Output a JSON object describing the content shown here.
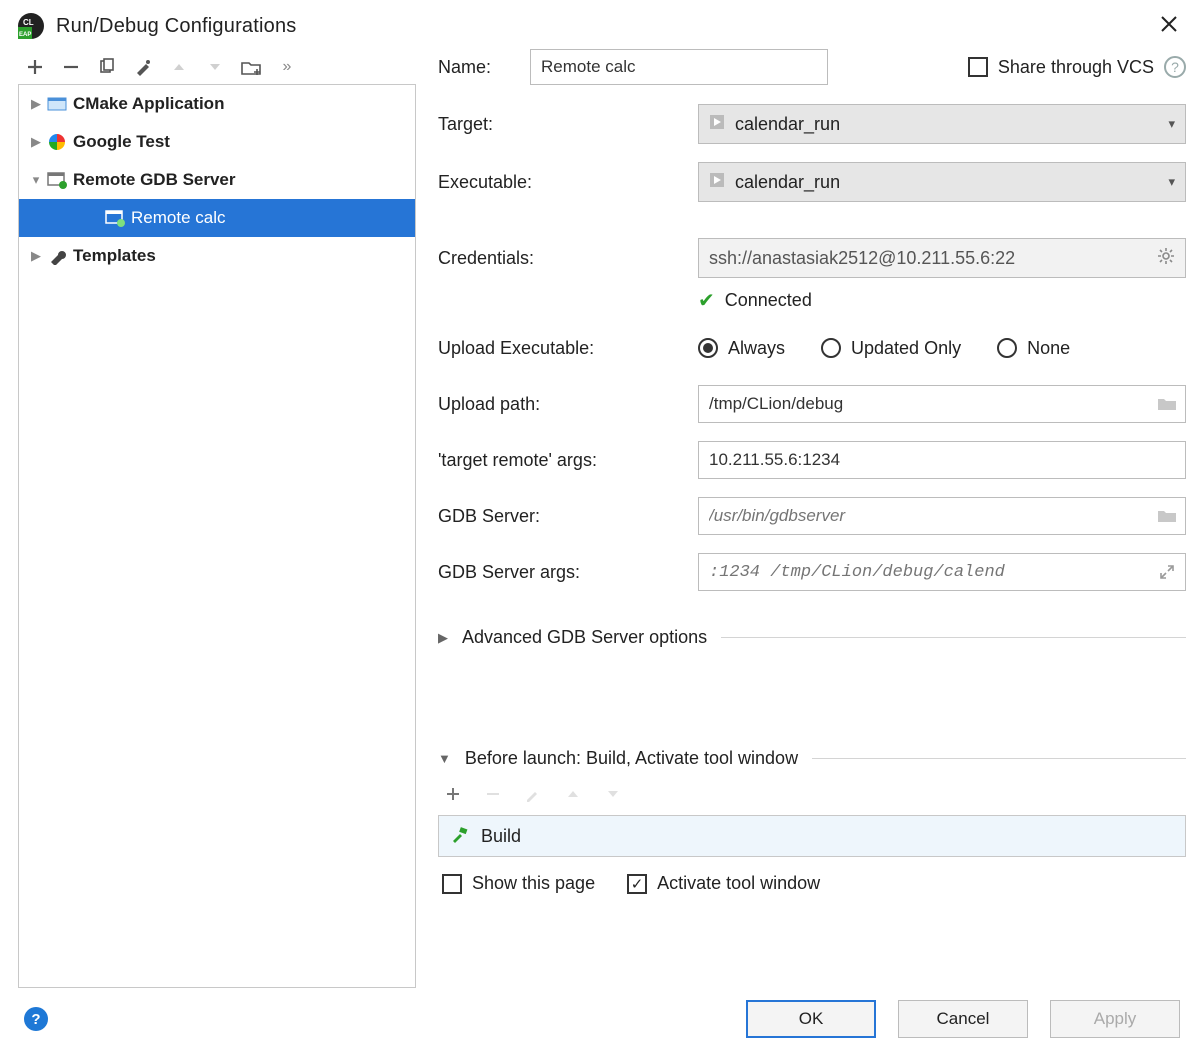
{
  "window": {
    "title": "Run/Debug Configurations"
  },
  "tree": {
    "items": [
      {
        "label": "CMake Application",
        "expandable": true,
        "expanded": false
      },
      {
        "label": "Google Test",
        "expandable": true,
        "expanded": false
      },
      {
        "label": "Remote GDB Server",
        "expandable": true,
        "expanded": true,
        "children": [
          {
            "label": "Remote calc",
            "selected": true
          }
        ]
      },
      {
        "label": "Templates",
        "expandable": true,
        "expanded": false
      }
    ]
  },
  "form": {
    "name_label": "Name:",
    "name_value": "Remote calc",
    "share_label": "Share through VCS",
    "target_label": "Target:",
    "target_value": "calendar_run",
    "executable_label": "Executable:",
    "executable_value": "calendar_run",
    "credentials_label": "Credentials:",
    "credentials_value": "ssh://anastasiak2512@10.211.55.6:22",
    "status": "Connected",
    "upload_exec_label": "Upload Executable:",
    "upload_options": {
      "always": "Always",
      "updated": "Updated Only",
      "none": "None",
      "selected": "always"
    },
    "upload_path_label": "Upload path:",
    "upload_path_value": "/tmp/CLion/debug",
    "target_remote_args_label": "'target remote' args:",
    "target_remote_args_value": "10.211.55.6:1234",
    "gdb_server_label": "GDB Server:",
    "gdb_server_placeholder": "/usr/bin/gdbserver",
    "gdb_server_args_label": "GDB Server args:",
    "gdb_server_args_placeholder": ":1234 /tmp/CLion/debug/calend",
    "advanced_label": "Advanced GDB Server options",
    "before_launch_label": "Before launch: Build, Activate tool window",
    "before_launch_items": [
      {
        "label": "Build"
      }
    ],
    "show_page_label": "Show this page",
    "activate_window_label": "Activate tool window"
  },
  "buttons": {
    "ok": "OK",
    "cancel": "Cancel",
    "apply": "Apply"
  }
}
